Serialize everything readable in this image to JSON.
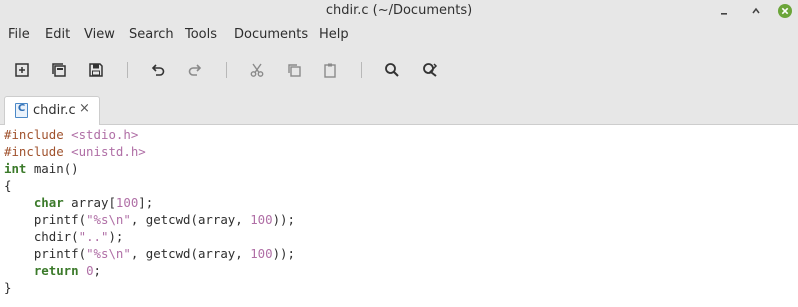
{
  "window": {
    "title": "chdir.c (~/Documents)"
  },
  "menubar": {
    "items": [
      "File",
      "Edit",
      "View",
      "Search",
      "Tools",
      "Documents",
      "Help"
    ]
  },
  "toolbar": {
    "icons": [
      "new-document-icon",
      "open-recent-icon",
      "save-icon",
      "undo-icon",
      "redo-icon",
      "cut-icon",
      "copy-icon",
      "paste-icon",
      "search-icon",
      "replace-icon"
    ]
  },
  "tabs": [
    {
      "label": "chdir.c",
      "icon_letter": "C",
      "close_glyph": "×"
    }
  ],
  "editor": {
    "lines": [
      [
        {
          "t": "#include ",
          "c": "pp"
        },
        {
          "t": "<stdio.h>",
          "c": "str"
        }
      ],
      [
        {
          "t": "#include ",
          "c": "pp"
        },
        {
          "t": "<unistd.h>",
          "c": "str"
        }
      ],
      [
        {
          "t": "int",
          "c": "kw"
        },
        {
          "t": " main()",
          "c": ""
        }
      ],
      [
        {
          "t": "{",
          "c": ""
        }
      ],
      [
        {
          "t": "    ",
          "c": ""
        },
        {
          "t": "char",
          "c": "kw"
        },
        {
          "t": " array[",
          "c": ""
        },
        {
          "t": "100",
          "c": "num"
        },
        {
          "t": "];",
          "c": ""
        }
      ],
      [
        {
          "t": "    printf(",
          "c": ""
        },
        {
          "t": "\"%s\\n\"",
          "c": "str"
        },
        {
          "t": ", getcwd(array, ",
          "c": ""
        },
        {
          "t": "100",
          "c": "num"
        },
        {
          "t": "));",
          "c": ""
        }
      ],
      [
        {
          "t": "    chdir(",
          "c": ""
        },
        {
          "t": "\"..\"",
          "c": "str"
        },
        {
          "t": ");",
          "c": ""
        }
      ],
      [
        {
          "t": "    printf(",
          "c": ""
        },
        {
          "t": "\"%s\\n\"",
          "c": "str"
        },
        {
          "t": ", getcwd(array, ",
          "c": ""
        },
        {
          "t": "100",
          "c": "num"
        },
        {
          "t": "));",
          "c": ""
        }
      ],
      [
        {
          "t": "    ",
          "c": ""
        },
        {
          "t": "return",
          "c": "kw"
        },
        {
          "t": " ",
          "c": ""
        },
        {
          "t": "0",
          "c": "num"
        },
        {
          "t": ";",
          "c": ""
        }
      ],
      [
        {
          "t": "}",
          "c": ""
        }
      ]
    ]
  },
  "colors": {
    "chrome": "#e7e7e7",
    "preprocessor": "#a0522d",
    "string": "#b06fa6",
    "keyword": "#3b7a2a",
    "close_button": "#6ba539"
  }
}
